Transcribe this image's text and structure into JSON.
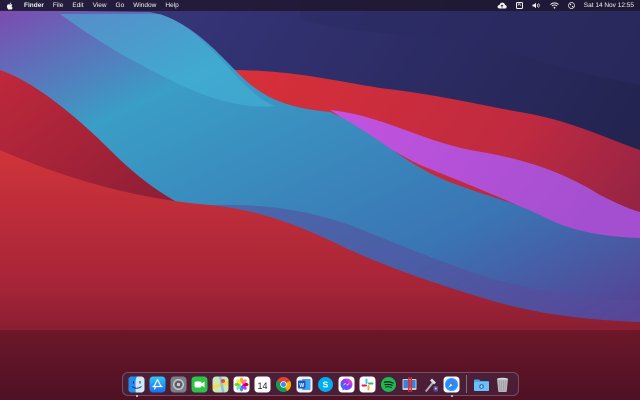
{
  "menubar": {
    "app_name": "Finder",
    "menus": [
      "File",
      "Edit",
      "View",
      "Go",
      "Window",
      "Help"
    ],
    "input_source": "A",
    "clock": "Sat 14 Nov  12:55"
  },
  "dock": {
    "apps": [
      {
        "name": "Finder",
        "icon": "finder-icon",
        "running": true
      },
      {
        "name": "App Store",
        "icon": "app-store-icon"
      },
      {
        "name": "System Preferences",
        "icon": "system-preferences-icon"
      },
      {
        "name": "FaceTime",
        "icon": "facetime-icon"
      },
      {
        "name": "Maps",
        "icon": "maps-icon"
      },
      {
        "name": "Photos",
        "icon": "photos-icon"
      },
      {
        "name": "Calendar",
        "icon": "calendar-icon",
        "day": "14"
      },
      {
        "name": "Google Chrome",
        "icon": "chrome-icon"
      },
      {
        "name": "Microsoft Word",
        "icon": "word-icon",
        "letter": "W"
      },
      {
        "name": "Skype",
        "icon": "skype-icon",
        "letter": "S"
      },
      {
        "name": "Messenger",
        "icon": "messenger-icon"
      },
      {
        "name": "Slack",
        "icon": "slack-icon"
      },
      {
        "name": "Spotify",
        "icon": "spotify-icon"
      },
      {
        "name": "Parallels",
        "icon": "parallels-icon"
      },
      {
        "name": "Automator",
        "icon": "automator-icon"
      },
      {
        "name": "Safari",
        "icon": "safari-icon",
        "running": true
      }
    ],
    "others": [
      {
        "name": "Downloads",
        "icon": "downloads-folder-icon"
      },
      {
        "name": "Trash",
        "icon": "trash-icon"
      }
    ]
  }
}
